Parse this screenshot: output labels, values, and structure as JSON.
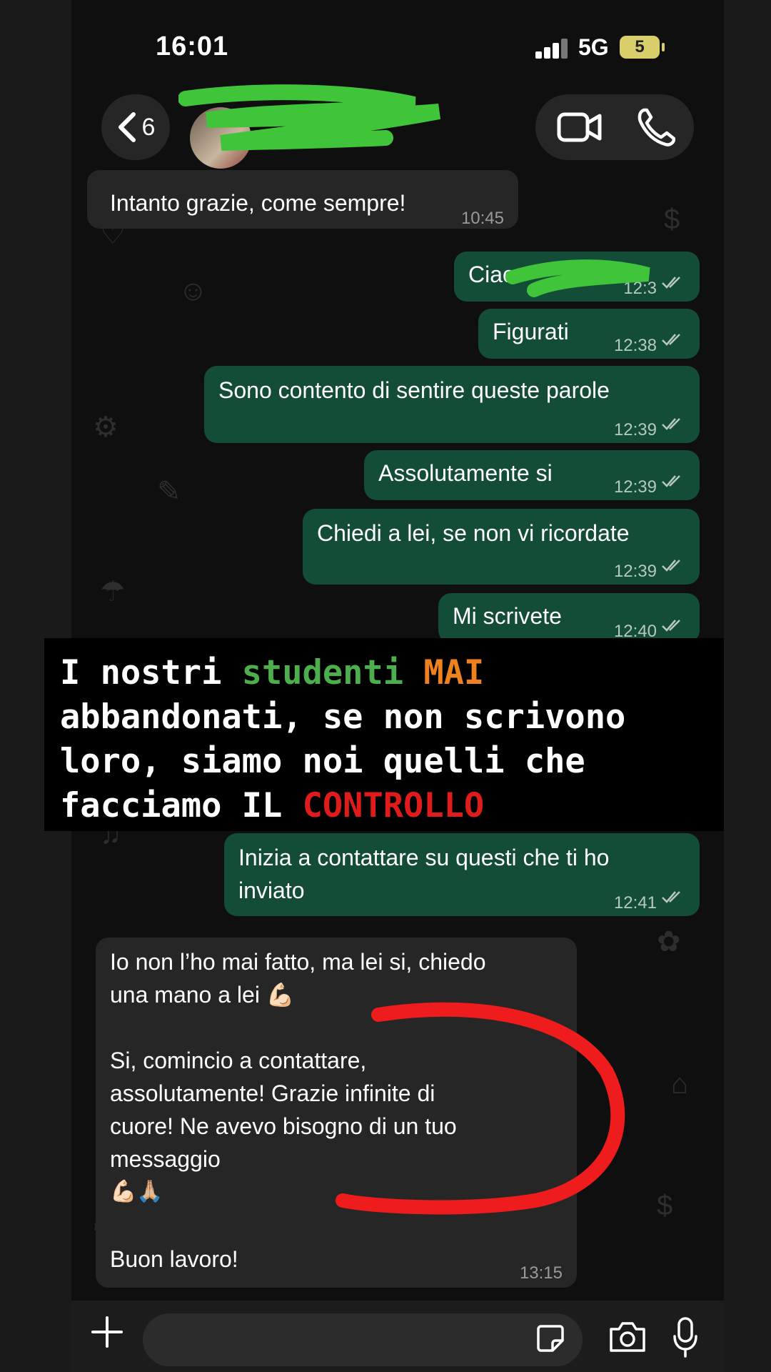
{
  "status": {
    "time": "16:01",
    "network": "5G",
    "battery": "5"
  },
  "header": {
    "back_count": "6"
  },
  "messages": [
    {
      "dir": "in",
      "text": "Intanto grazie, come sempre!",
      "time": "10:45"
    },
    {
      "dir": "out",
      "text": "Ciao",
      "time": "12:3"
    },
    {
      "dir": "out",
      "text": "Figurati",
      "time": "12:38"
    },
    {
      "dir": "out",
      "text": "Sono contento di sentire queste parole",
      "time": "12:39"
    },
    {
      "dir": "out",
      "text": "Assolutamente si",
      "time": "12:39"
    },
    {
      "dir": "out",
      "text": "Chiedi a lei, se non vi ricordate",
      "time": "12:39"
    },
    {
      "dir": "out",
      "text": "Mi scrivete",
      "time": "12:40"
    },
    {
      "dir": "out",
      "text_lines": [
        "Inizia a contattare su questi che ti ho",
        "inviato"
      ],
      "time": "12:41"
    },
    {
      "dir": "in",
      "text_lines": [
        "Io non l’ho mai fatto, ma lei si, chiedo",
        "una mano a lei 💪🏻",
        "",
        "Si, comincio a contattare,",
        "assolutamente! Grazie infinite di",
        "cuore! Ne avevo bisogno di un tuo",
        "messaggio",
        "💪🏻🙏🏼",
        "",
        "Buon lavoro!"
      ],
      "time": "13:15"
    }
  ],
  "banner": {
    "parts": {
      "p1": "I nostri ",
      "p2": "studenti",
      "p3": " ",
      "p4": "MAI",
      "p5": "\nabbandonati, se non scrivono\nloro, siamo noi quelli che\nfacciamo IL ",
      "p6": "CONTROLLO"
    },
    "colors": {
      "highlight_green": "#4cae4c",
      "highlight_orange": "#f0821e",
      "highlight_red": "#e01b1b"
    }
  },
  "composer": {
    "placeholder": ""
  },
  "icons": [
    "back-chevron-icon",
    "video-call-icon",
    "voice-call-icon",
    "plus-icon",
    "sticker-icon",
    "camera-icon",
    "microphone-icon",
    "double-check-icon"
  ],
  "colors": {
    "outgoing_bubble": "#134d37",
    "incoming_bubble": "#262626",
    "background": "#0f0f0f"
  }
}
